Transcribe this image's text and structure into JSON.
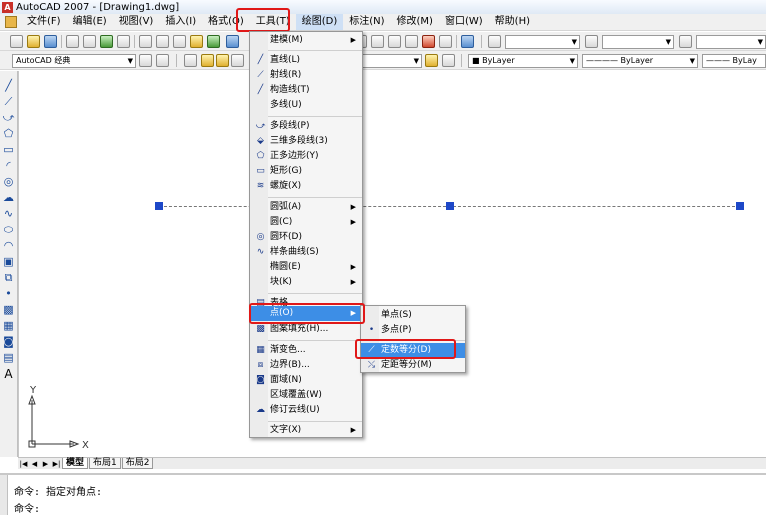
{
  "window": {
    "title": "AutoCAD 2007 - [Drawing1.dwg]"
  },
  "menubar": {
    "items": [
      {
        "label": "文件(F)"
      },
      {
        "label": "编辑(E)"
      },
      {
        "label": "视图(V)"
      },
      {
        "label": "插入(I)"
      },
      {
        "label": "格式(O)"
      },
      {
        "label": "工具(T)"
      },
      {
        "label": "绘图(D)"
      },
      {
        "label": "标注(N)"
      },
      {
        "label": "修改(M)"
      },
      {
        "label": "窗口(W)"
      },
      {
        "label": "帮助(H)"
      }
    ]
  },
  "toolbar2": {
    "workspace": "AutoCAD 经典",
    "color": "ByLayer",
    "linetype": "ByLayer",
    "lineweight": "ByLay"
  },
  "draw_menu": {
    "items": [
      {
        "label": "建模(M)",
        "icon": "none",
        "submenu": true
      },
      {
        "label": "直线(L)",
        "icon": "line-icon"
      },
      {
        "label": "射线(R)",
        "icon": "ray-icon"
      },
      {
        "label": "构造线(T)",
        "icon": "construction-line-icon"
      },
      {
        "label": "多线(U)",
        "icon": "none"
      },
      {
        "label": "多段线(P)",
        "icon": "polyline-icon"
      },
      {
        "label": "三维多段线(3)",
        "icon": "3d-polyline-icon"
      },
      {
        "label": "正多边形(Y)",
        "icon": "polygon-icon"
      },
      {
        "label": "矩形(G)",
        "icon": "rectangle-icon"
      },
      {
        "label": "螺旋(X)",
        "icon": "helix-icon"
      },
      {
        "label": "圆弧(A)",
        "icon": "none",
        "submenu": true
      },
      {
        "label": "圆(C)",
        "icon": "none",
        "submenu": true
      },
      {
        "label": "圆环(D)",
        "icon": "donut-icon"
      },
      {
        "label": "样条曲线(S)",
        "icon": "spline-icon"
      },
      {
        "label": "椭圆(E)",
        "icon": "none",
        "submenu": true
      },
      {
        "label": "块(K)",
        "icon": "none",
        "submenu": true
      },
      {
        "label": "表格...",
        "icon": "table-icon"
      },
      {
        "label": "点(O)",
        "icon": "none",
        "submenu": true
      },
      {
        "label": "图案填充(H)...",
        "icon": "hatch-icon"
      },
      {
        "label": "渐变色...",
        "icon": "gradient-icon"
      },
      {
        "label": "边界(B)...",
        "icon": "boundary-icon"
      },
      {
        "label": "面域(N)",
        "icon": "region-icon"
      },
      {
        "label": "区域覆盖(W)",
        "icon": "none"
      },
      {
        "label": "修订云线(U)",
        "icon": "revcloud-icon"
      },
      {
        "label": "文字(X)",
        "icon": "none",
        "submenu": true
      }
    ]
  },
  "point_submenu": {
    "items": [
      {
        "label": "单点(S)"
      },
      {
        "label": "多点(P)"
      },
      {
        "label": "定数等分(D)"
      },
      {
        "label": "定距等分(M)"
      }
    ]
  },
  "layout_tabs": [
    "模型",
    "布局1",
    "布局2"
  ],
  "command": {
    "history": "命令: 指定对角点:",
    "prompt": "命令:"
  },
  "ucs": {
    "x_label": "X",
    "y_label": "Y"
  },
  "colors": {
    "highlight": "#3d8ee6",
    "grip": "#1d48c8",
    "annotation": "#e01818"
  }
}
